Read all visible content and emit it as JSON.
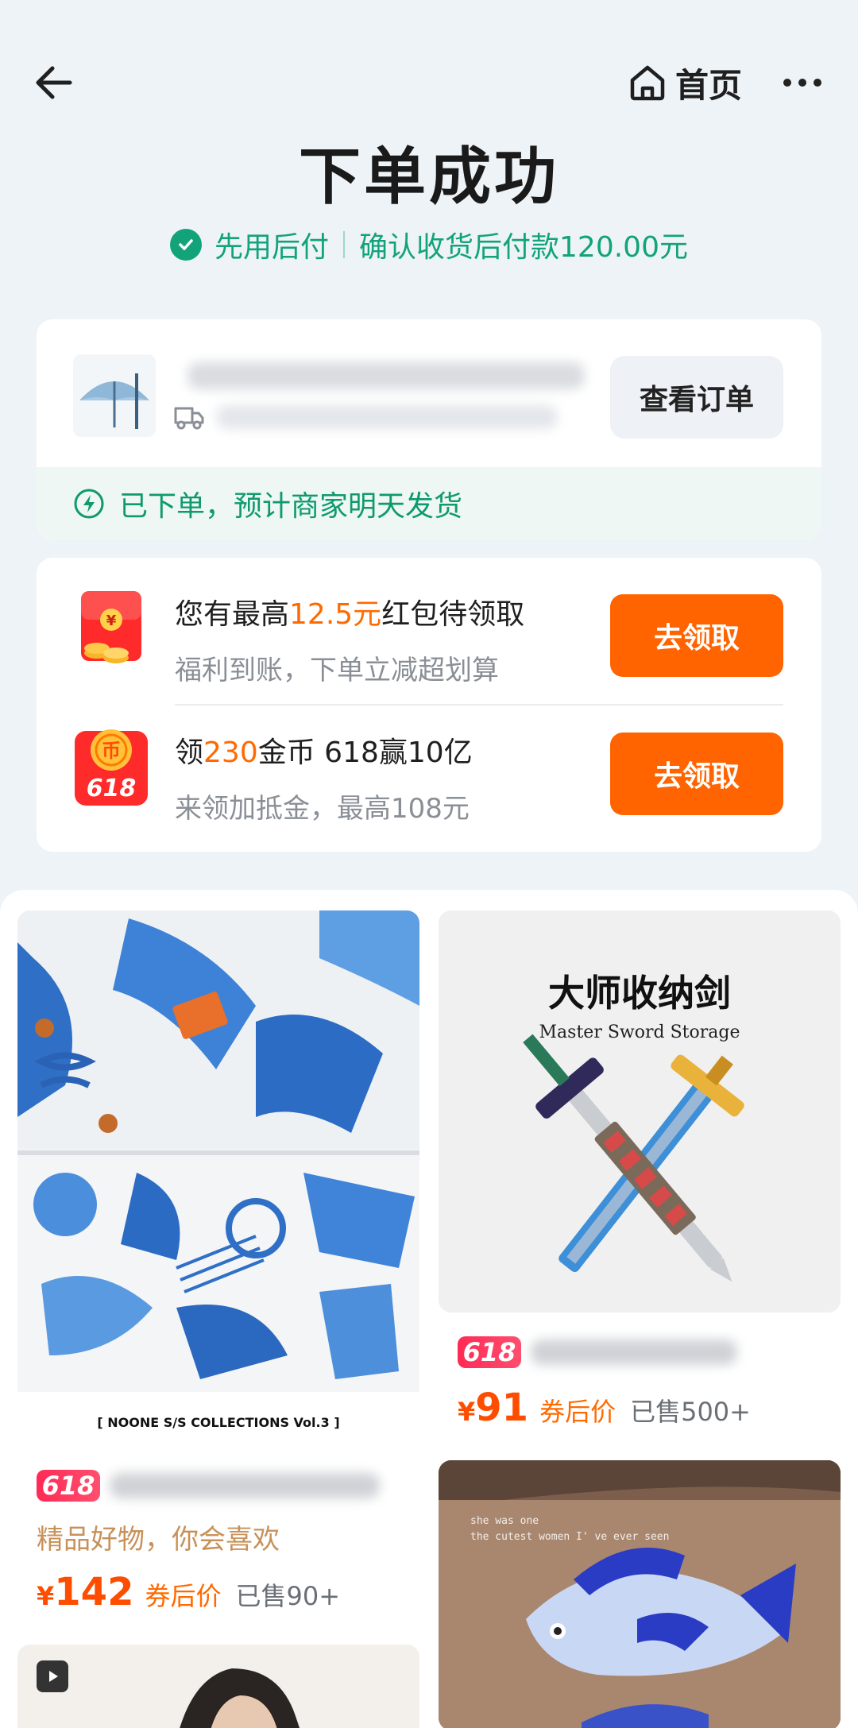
{
  "header": {
    "home_label": "首页",
    "title": "下单成功",
    "pay_mode": "先用后付",
    "pay_note": "确认收货后付款120.00元"
  },
  "order": {
    "view_order_label": "查看订单",
    "ship_status": "已下单，预计商家明天发货"
  },
  "rewards": [
    {
      "main_pre": "您有最高",
      "main_hl": "12.5元",
      "main_post": "红包待领取",
      "sub": "福利到账，下单立减超划算",
      "button": "去领取"
    },
    {
      "main_pre": "领",
      "main_hl": "230",
      "main_post": "金币 618赢10亿",
      "sub": "来领加抵金，最高108元",
      "button": "去领取"
    }
  ],
  "feed": {
    "items": [
      {
        "badge": "618",
        "image_caption": "[ NOONE S/S COLLECTIONS Vol.3 ]",
        "slogan": "精品好物，你会喜欢",
        "yen": "¥",
        "price": "142",
        "price_note": "券后价",
        "sold": "已售90+"
      },
      {
        "badge": "618",
        "image_title": "大师收纳剑",
        "image_subtitle": "Master Sword Storage",
        "yen": "¥",
        "price": "91",
        "price_note": "券后价",
        "sold": "已售500+"
      },
      {
        "image_caption_1": "she was one",
        "image_caption_2": "the cutest women I' ve ever seen"
      }
    ]
  },
  "colors": {
    "accent_green": "#12a37a",
    "accent_orange": "#ff6400",
    "badge_red": "#ff2a55"
  }
}
